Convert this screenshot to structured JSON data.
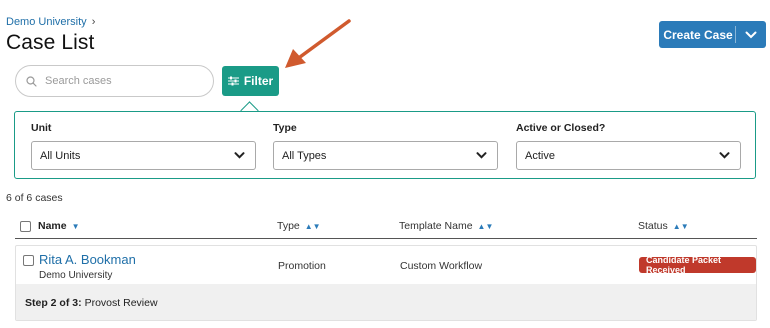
{
  "breadcrumb": {
    "parent": "Demo University",
    "separator": "›"
  },
  "page": {
    "title": "Case List"
  },
  "actions": {
    "create_case": "Create Case"
  },
  "search": {
    "placeholder": "Search cases",
    "value": ""
  },
  "filter": {
    "button_label": "Filter"
  },
  "filters": {
    "unit": {
      "label": "Unit",
      "value": "All Units"
    },
    "type": {
      "label": "Type",
      "value": "All Types"
    },
    "active": {
      "label": "Active or Closed?",
      "value": "Active"
    }
  },
  "results": {
    "count_text": "6 of 6 cases"
  },
  "table": {
    "columns": {
      "name": "Name",
      "type": "Type",
      "template": "Template Name",
      "status": "Status"
    },
    "rows": [
      {
        "name": "Rita A. Bookman",
        "unit": "Demo University",
        "type": "Promotion",
        "template": "Custom Workflow",
        "status": "Candidate Packet Received",
        "step_label": "Step 2 of 3:",
        "step_value": "Provost Review"
      }
    ]
  },
  "colors": {
    "primary": "#2b7bb9",
    "accent": "#1a9b87",
    "status_red": "#c0392b",
    "annotation_arrow": "#d05a2e"
  },
  "icons": {
    "search": "search-icon",
    "filter": "sliders-icon",
    "dropdown": "chevron-down-icon",
    "sort": "sort-icon",
    "annotation": "arrow-icon"
  }
}
